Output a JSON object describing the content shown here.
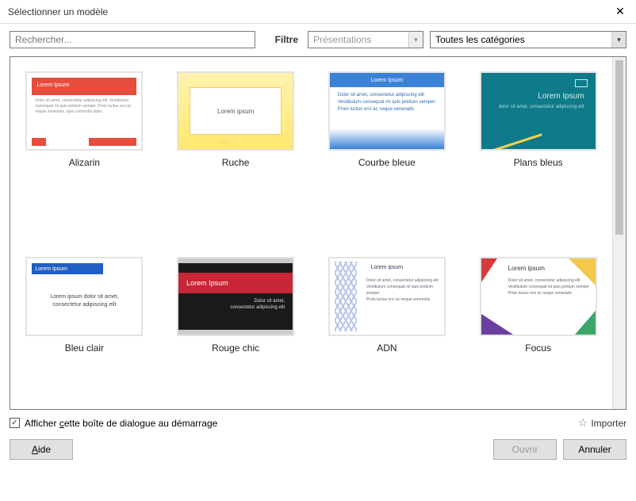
{
  "window": {
    "title": "Sélectionner un modèle"
  },
  "toolbar": {
    "search_placeholder": "Rechercher...",
    "filter_label": "Filtre",
    "filter_value": "Présentations",
    "category_value": "Toutes les catégories"
  },
  "templates": [
    {
      "name": "Alizarin"
    },
    {
      "name": "Ruche"
    },
    {
      "name": "Courbe bleue"
    },
    {
      "name": "Plans bleus"
    },
    {
      "name": "Bleu clair"
    },
    {
      "name": "Rouge chic"
    },
    {
      "name": "ADN"
    },
    {
      "name": "Focus"
    }
  ],
  "thumb_text": {
    "lorem_ipsum_title": "Lorem Ipsum",
    "lorem_ipsum_lower": "Lorem ipsum",
    "lines3": "Dolor sit amet, consectetur adipiscing elit\nVestibulum consequat mi quis pretium semper\nProin luctus orci ac neque venenatis",
    "sub_amet": "dolor sit amet, consectetur adipiscing elit",
    "dolor_2line": "Lorem ipsum dolor sit amet,\nconsectetur adipiscing elit",
    "dolor_2line_b": "Dolor sit amet,\nconsectetur adipiscing elit",
    "lipsum_para": "Dolor sit amet, consectetur adipiscing elit. Vestibulum consequat mi quis pretium semper. Proin luctus orci ac neque venenatis, quis commodo dolor."
  },
  "options": {
    "show_at_startup_checked": true,
    "show_at_startup_pre": "Afficher ",
    "show_at_startup_u": "c",
    "show_at_startup_post": "ette boîte de dialogue au démarrage",
    "import_label": "Importer"
  },
  "buttons": {
    "help": "Aide",
    "open": "Ouvrir",
    "cancel": "Annuler"
  }
}
